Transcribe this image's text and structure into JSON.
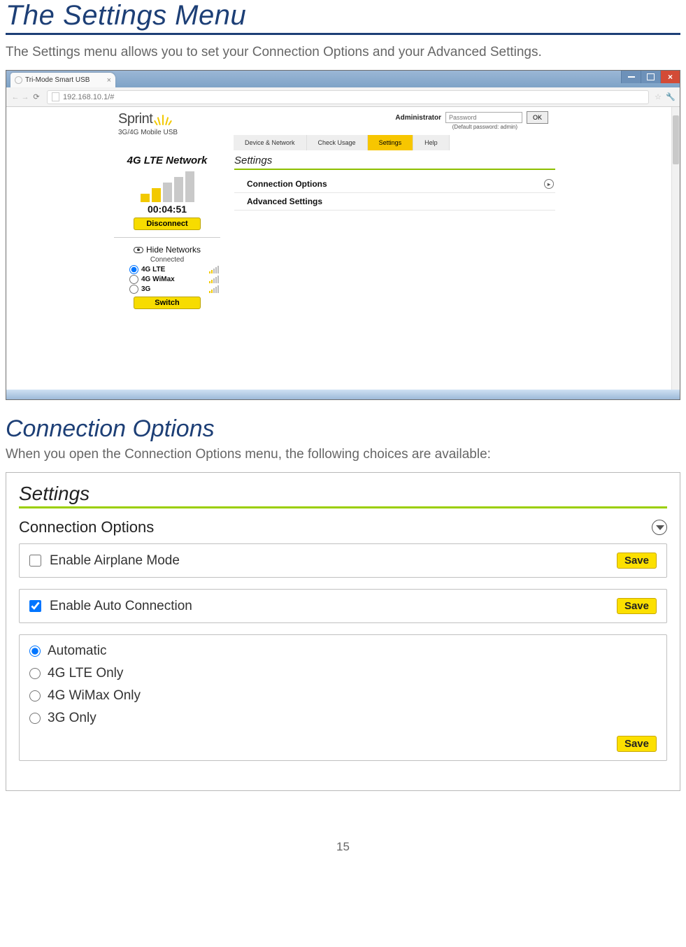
{
  "doc": {
    "title": "The Settings Menu",
    "lead": "The Settings menu allows you to set your Connection Options and your Advanced Settings.",
    "section2_title": "Connection Options",
    "section2_lead": "When you open the Connection Options menu, the following choices are available:",
    "page_number": "15"
  },
  "browser": {
    "tab_title": "Tri-Mode Smart USB",
    "address": "192.168.10.1/#"
  },
  "header": {
    "brand": "Sprint",
    "subtitle": "3G/4G Mobile USB",
    "admin_label": "Administrator",
    "password_placeholder": "Password",
    "ok": "OK",
    "default_note": "(Default password: admin)",
    "nav": {
      "item0": "Device & Network",
      "item1": "Check Usage",
      "item2": "Settings",
      "item3": "Help"
    }
  },
  "left": {
    "network_title": "4G LTE Network",
    "timer": "00:04:51",
    "disconnect": "Disconnect",
    "hide": "Hide Networks",
    "connected": "Connected",
    "net0": "4G LTE",
    "net1": "4G WiMax",
    "net2": "3G",
    "switch": "Switch"
  },
  "panel": {
    "heading": "Settings",
    "row0": "Connection Options",
    "row1": "Advanced Settings"
  },
  "shot2": {
    "heading": "Settings",
    "section": "Connection Options",
    "opt_airplane": "Enable Airplane Mode",
    "opt_auto": "Enable Auto Connection",
    "save": "Save",
    "r0": "Automatic",
    "r1": "4G LTE Only",
    "r2": "4G WiMax Only",
    "r3": "3G Only"
  }
}
